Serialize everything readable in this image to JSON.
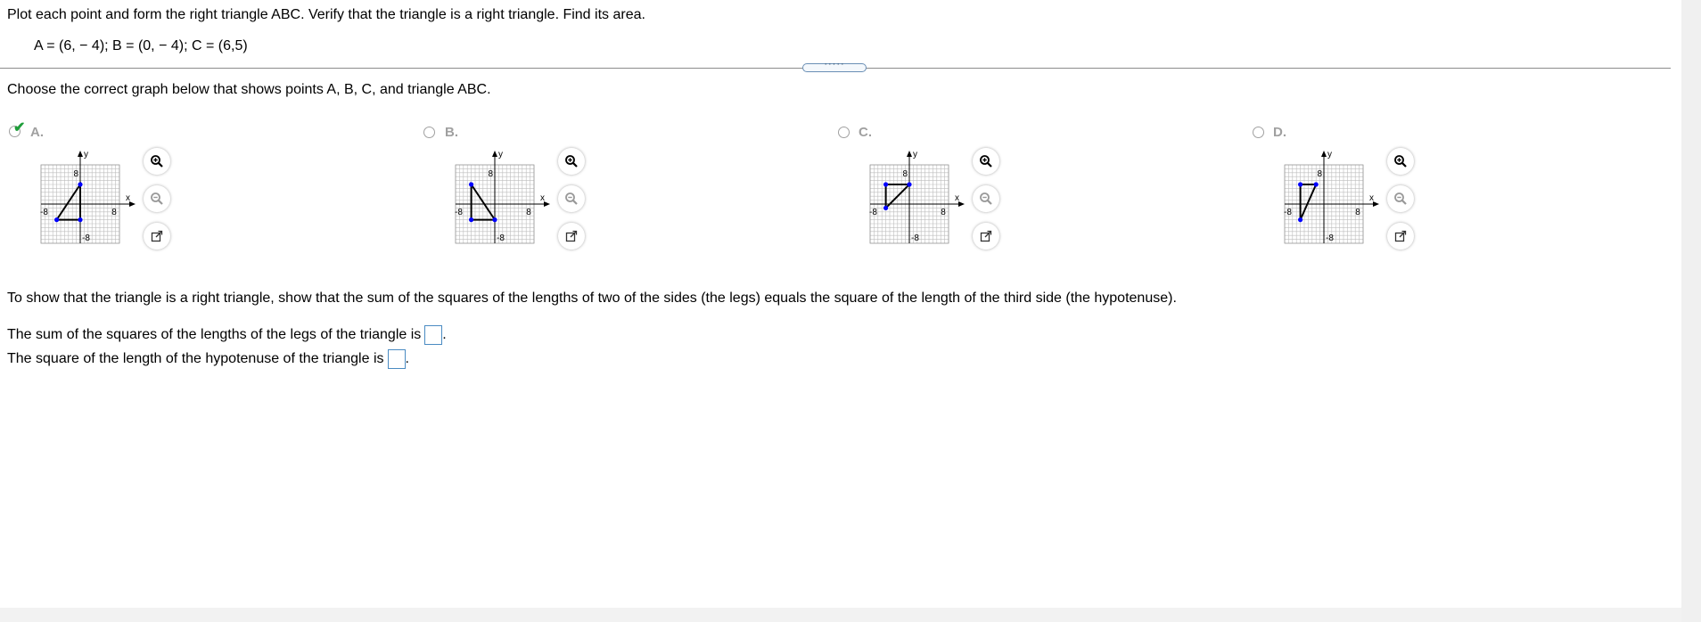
{
  "problem": {
    "instruction": "Plot each point and form the right triangle ABC. Verify that the triangle is a right triangle. Find its area.",
    "points": "A = (6, − 4);   B = (0, − 4);   C = (6,5)"
  },
  "question": {
    "choose_prompt": "Choose the correct graph below that shows points A, B, C, and triangle ABC.",
    "splitter_label": "·····",
    "options": [
      {
        "label": "A.",
        "selected": true
      },
      {
        "label": "B.",
        "selected": false
      },
      {
        "label": "C.",
        "selected": false
      },
      {
        "label": "D.",
        "selected": false
      }
    ],
    "graph_labels": {
      "x": "x",
      "y": "y",
      "neg": "-8",
      "pos": "8"
    }
  },
  "verify": {
    "explanation": "To show that the triangle is a right triangle, show that the sum of the squares of the lengths of two of the sides (the legs) equals the square of the length of the third side (the hypotenuse).",
    "legs_label": "The sum of the squares of the lengths of the legs of the triangle is",
    "legs_value": "",
    "hyp_label": "The square of the length of the hypotenuse of the triangle is",
    "hyp_value": "",
    "period": "."
  },
  "icons": {
    "zoom_in": "zoom-in-icon",
    "zoom_out": "zoom-out-icon",
    "popout": "popout-icon",
    "check": "checkmark-icon"
  },
  "colors": {
    "point": "#0000ff",
    "check": "#1f9e3a",
    "answer_border": "#4a8bc2"
  }
}
